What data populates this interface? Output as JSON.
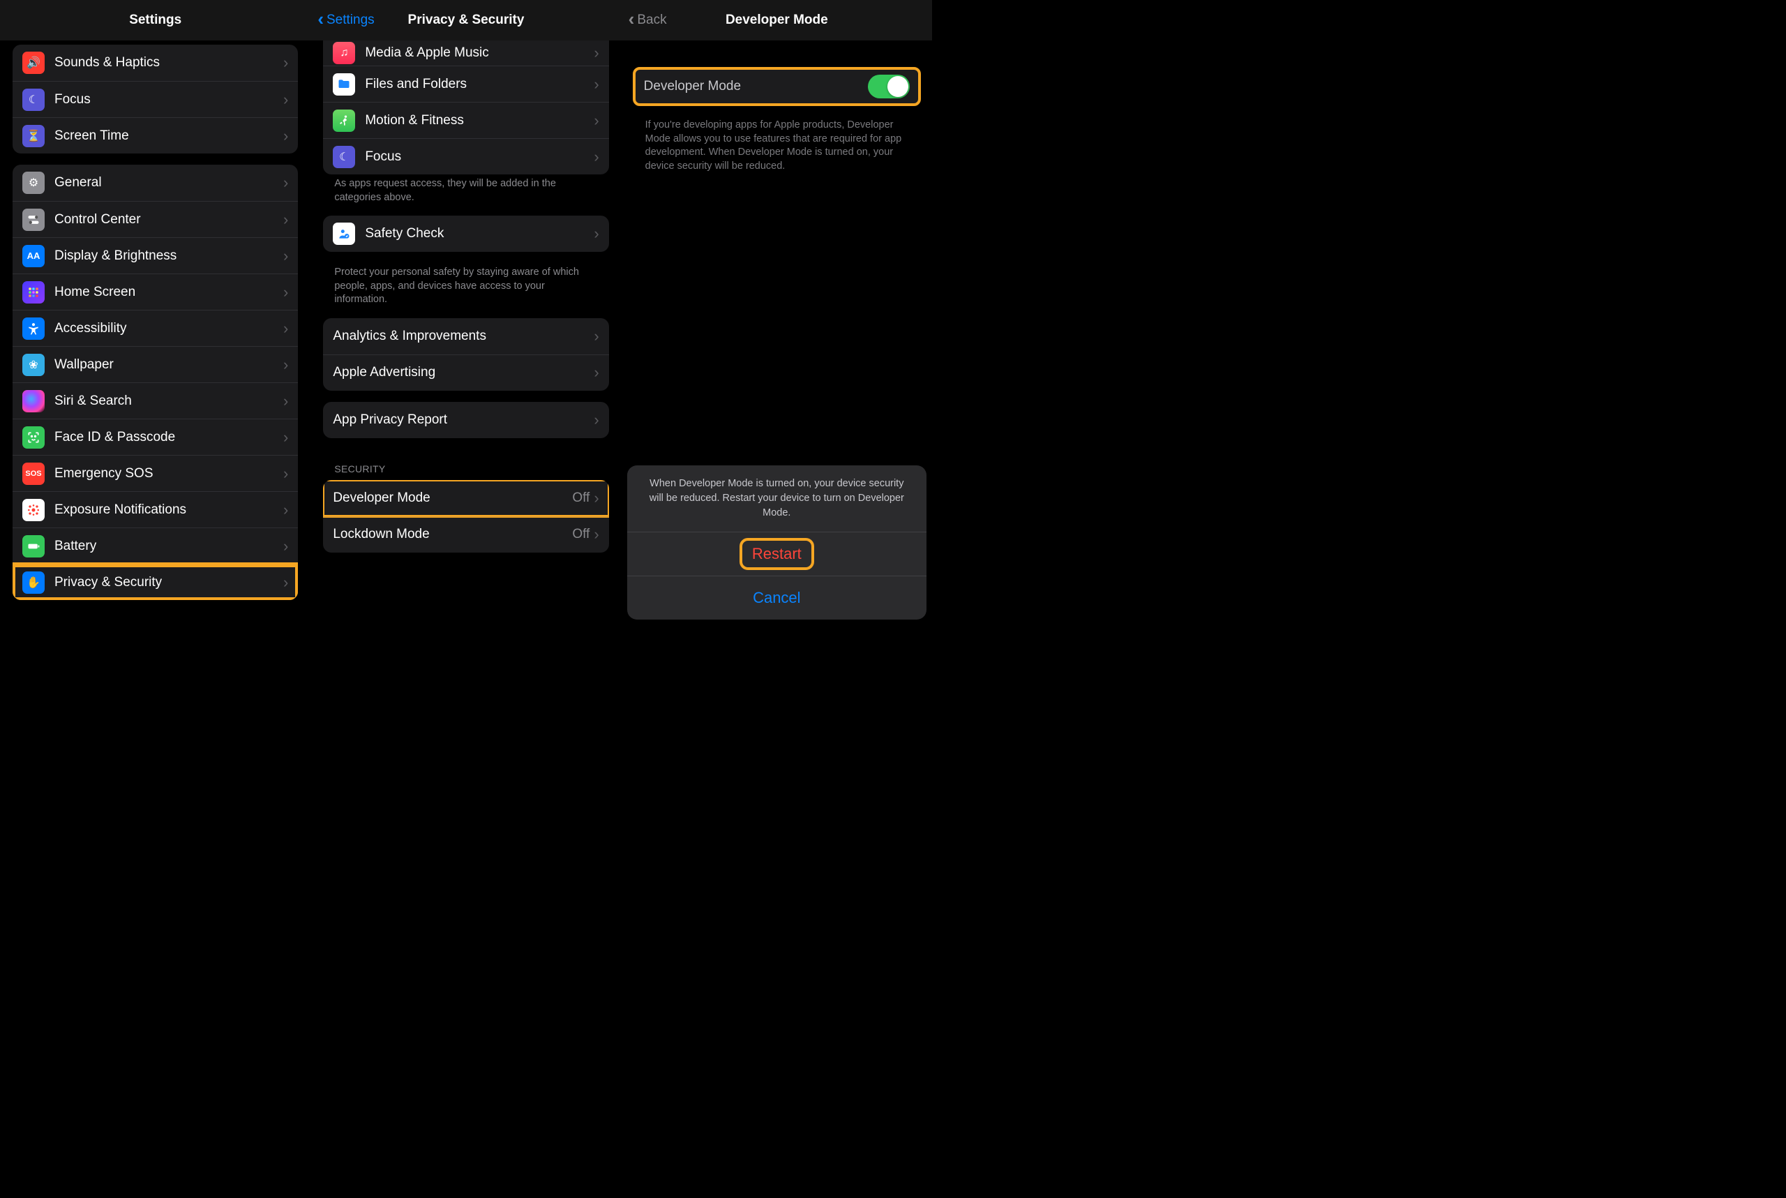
{
  "panel1": {
    "title": "Settings",
    "group_a": [
      {
        "icon": "speaker-icon",
        "color": "bg-red",
        "label": "Sounds & Haptics"
      },
      {
        "icon": "moon-icon",
        "color": "bg-purple",
        "label": "Focus"
      },
      {
        "icon": "hourglass-icon",
        "color": "bg-purple",
        "label": "Screen Time"
      }
    ],
    "group_b": [
      {
        "icon": "gear-icon",
        "color": "bg-grey",
        "label": "General"
      },
      {
        "icon": "switches-icon",
        "color": "bg-grey",
        "label": "Control Center"
      },
      {
        "icon": "text-size-icon",
        "color": "bg-blue",
        "label": "Display & Brightness"
      },
      {
        "icon": "grid-icon",
        "color": "bg-blue",
        "label": "Home Screen"
      },
      {
        "icon": "accessibility-icon",
        "color": "bg-blue",
        "label": "Accessibility"
      },
      {
        "icon": "flower-icon",
        "color": "bg-cyan",
        "label": "Wallpaper"
      },
      {
        "icon": "siri-icon",
        "color": "bg-black",
        "label": "Siri & Search"
      },
      {
        "icon": "faceid-icon",
        "color": "bg-green",
        "label": "Face ID & Passcode"
      },
      {
        "icon": "sos-icon",
        "color": "bg-red",
        "label": "Emergency SOS"
      },
      {
        "icon": "virus-icon",
        "color": "bg-dots",
        "label": "Exposure Notifications"
      },
      {
        "icon": "battery-icon",
        "color": "bg-green",
        "label": "Battery"
      },
      {
        "icon": "hand-icon",
        "color": "bg-blue",
        "label": "Privacy & Security",
        "highlight": true
      }
    ]
  },
  "panel2": {
    "back_label": "Settings",
    "title": "Privacy & Security",
    "group_cut": [
      {
        "icon": "music-icon",
        "color": "bg-red",
        "label": "Media & Apple Music"
      },
      {
        "icon": "folder-icon",
        "color": "bg-white",
        "label": "Files and Folders"
      },
      {
        "icon": "runner-icon",
        "color": "bg-green",
        "label": "Motion & Fitness"
      },
      {
        "icon": "moon-icon",
        "color": "bg-purple",
        "label": "Focus"
      }
    ],
    "cut_footer": "As apps request access, they will be added in the categories above.",
    "group_safety": [
      {
        "icon": "person-check-icon",
        "color": "bg-white",
        "label": "Safety Check"
      }
    ],
    "safety_footer": "Protect your personal safety by staying aware of which people, apps, and devices have access to your information.",
    "group_analytics": [
      {
        "label": "Analytics & Improvements"
      },
      {
        "label": "Apple Advertising"
      }
    ],
    "group_privacy_report": [
      {
        "label": "App Privacy Report"
      }
    ],
    "security_header": "SECURITY",
    "group_security": [
      {
        "label": "Developer Mode",
        "detail": "Off",
        "highlight": true
      },
      {
        "label": "Lockdown Mode",
        "detail": "Off"
      }
    ]
  },
  "panel3": {
    "back_label": "Back",
    "title": "Developer Mode",
    "toggle_row": {
      "label": "Developer Mode",
      "on": true
    },
    "toggle_footer": "If you're developing apps for Apple products, Developer Mode allows you to use features that are required for app development. When Developer Mode is turned on, your device security will be reduced.",
    "sheet": {
      "message": "When Developer Mode is turned on, your device security will be reduced. Restart your device to turn on Developer Mode.",
      "restart": "Restart",
      "cancel": "Cancel"
    }
  }
}
